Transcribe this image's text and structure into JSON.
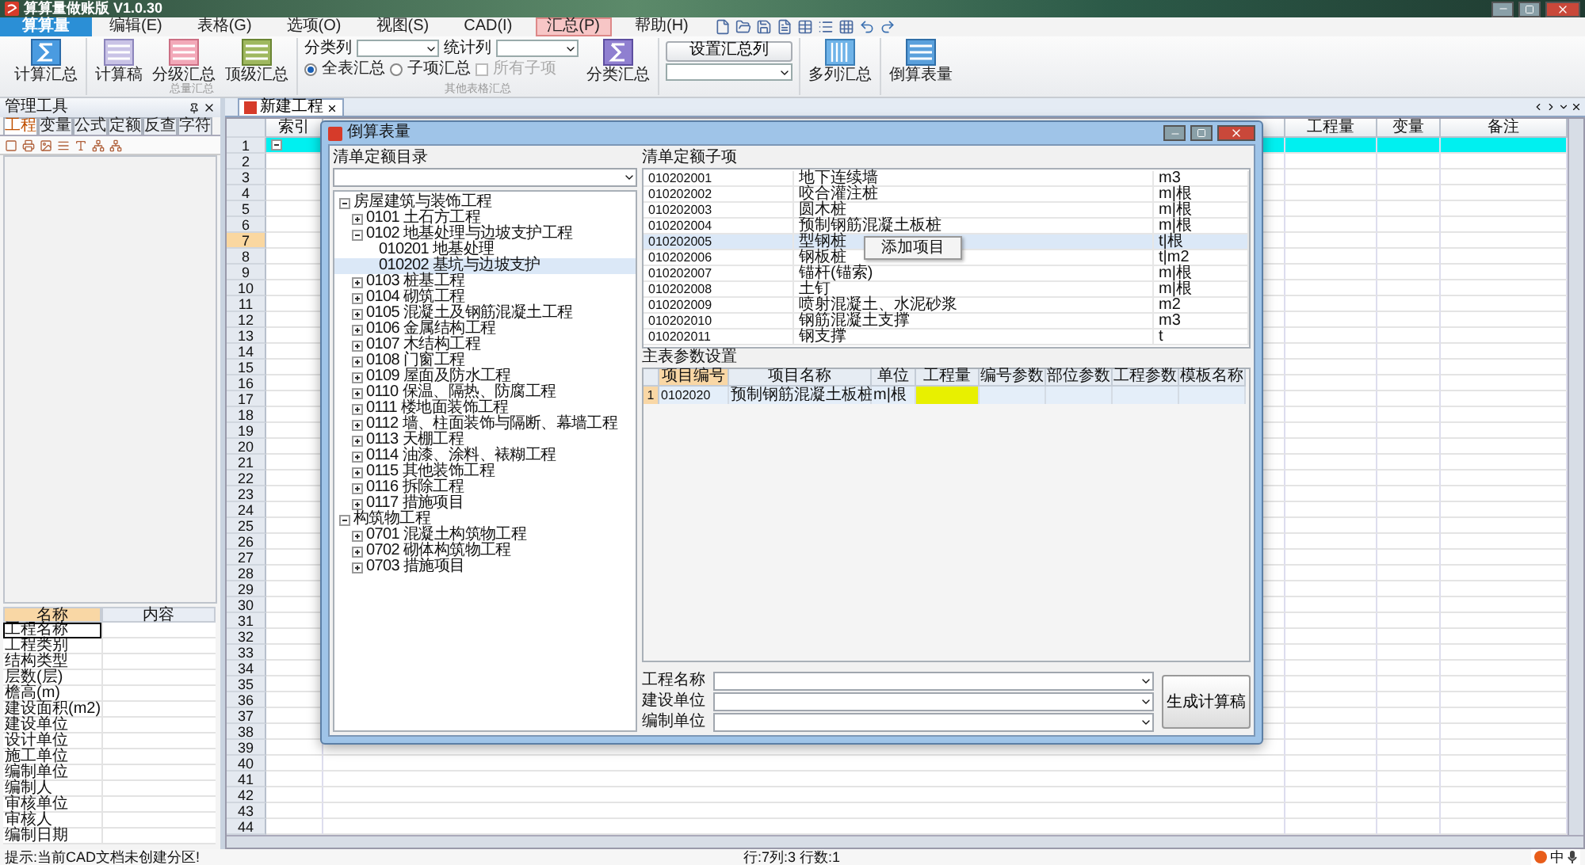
{
  "window": {
    "title": "算算量做账版 V1.0.30"
  },
  "app_button": {
    "label": "算算量"
  },
  "menu": [
    {
      "label": "编辑(E)",
      "selected": false
    },
    {
      "label": "表格(G)",
      "selected": false
    },
    {
      "label": "选项(O)",
      "selected": false
    },
    {
      "label": "视图(S)",
      "selected": false
    },
    {
      "label": "CAD(I)",
      "selected": false
    },
    {
      "label": "汇总(P)",
      "selected": true
    },
    {
      "label": "帮助(H)",
      "selected": false
    }
  ],
  "ribbon": {
    "sum_button": "计算汇总",
    "level_buttons": [
      "计算稿",
      "分级汇总",
      "顶级汇总"
    ],
    "level_group_label": "总量汇总",
    "category_label": "分类列",
    "stat_label": "统计列",
    "radios": [
      {
        "label": "全表汇总",
        "selected": true
      },
      {
        "label": "子项汇总",
        "selected": false
      }
    ],
    "all_children": {
      "label": "所有子项",
      "checked": false,
      "disabled": true
    },
    "category_button": "分类汇总",
    "other_group_label": "其他表格汇总",
    "set_columns_button": "设置汇总列",
    "multi_button": "多列汇总",
    "reverse_button": "倒算表量"
  },
  "left_panel": {
    "title": "管理工具",
    "tabs": [
      {
        "label": "工程",
        "selected": true
      },
      {
        "label": "变量",
        "selected": false
      },
      {
        "label": "公式",
        "selected": false
      },
      {
        "label": "定额",
        "selected": false
      },
      {
        "label": "反查",
        "selected": false
      },
      {
        "label": "字符",
        "selected": false
      }
    ],
    "properties": {
      "columns": [
        "名称",
        "内容"
      ],
      "rows": [
        {
          "name": "工程名称",
          "selected": true
        },
        {
          "name": "工程类别",
          "selected": false
        },
        {
          "name": "结构类型",
          "selected": false
        },
        {
          "name": "层数(层)",
          "selected": false
        },
        {
          "name": "檐高(m)",
          "selected": false
        },
        {
          "name": "建设面积(m2)",
          "selected": false
        },
        {
          "name": "建设单位",
          "selected": false
        },
        {
          "name": "设计单位",
          "selected": false
        },
        {
          "name": "施工单位",
          "selected": false
        },
        {
          "name": "编制单位",
          "selected": false
        },
        {
          "name": "编制人",
          "selected": false
        },
        {
          "name": "审核单位",
          "selected": false
        },
        {
          "name": "审核人",
          "selected": false
        },
        {
          "name": "编制日期",
          "selected": false
        }
      ]
    }
  },
  "document_tab": {
    "label": "新建工程"
  },
  "grid": {
    "columns": [
      "索引",
      "工程量",
      "变量",
      "备注"
    ],
    "rows": [
      {
        "number": "1",
        "selected": true,
        "current": false
      },
      {
        "number": "2",
        "selected": false,
        "current": false
      },
      {
        "number": "3",
        "selected": false,
        "current": false
      },
      {
        "number": "4",
        "selected": false,
        "current": false
      },
      {
        "number": "5",
        "selected": false,
        "current": false
      },
      {
        "number": "6",
        "selected": false,
        "current": false
      },
      {
        "number": "7",
        "selected": false,
        "current": true
      },
      {
        "number": "8",
        "selected": false,
        "current": false
      },
      {
        "number": "9",
        "selected": false,
        "current": false
      },
      {
        "number": "10",
        "selected": false,
        "current": false
      },
      {
        "number": "11",
        "selected": false,
        "current": false
      },
      {
        "number": "12",
        "selected": false,
        "current": false
      },
      {
        "number": "13",
        "selected": false,
        "current": false
      },
      {
        "number": "14",
        "selected": false,
        "current": false
      },
      {
        "number": "15",
        "selected": false,
        "current": false
      },
      {
        "number": "16",
        "selected": false,
        "current": false
      },
      {
        "number": "17",
        "selected": false,
        "current": false
      },
      {
        "number": "18",
        "selected": false,
        "current": false
      },
      {
        "number": "19",
        "selected": false,
        "current": false
      },
      {
        "number": "20",
        "selected": false,
        "current": false
      },
      {
        "number": "21",
        "selected": false,
        "current": false
      },
      {
        "number": "22",
        "selected": false,
        "current": false
      },
      {
        "number": "23",
        "selected": false,
        "current": false
      },
      {
        "number": "24",
        "selected": false,
        "current": false
      },
      {
        "number": "25",
        "selected": false,
        "current": false
      },
      {
        "number": "26",
        "selected": false,
        "current": false
      },
      {
        "number": "27",
        "selected": false,
        "current": false
      },
      {
        "number": "28",
        "selected": false,
        "current": false
      },
      {
        "number": "29",
        "selected": false,
        "current": false
      },
      {
        "number": "30",
        "selected": false,
        "current": false
      },
      {
        "number": "31",
        "selected": false,
        "current": false
      },
      {
        "number": "32",
        "selected": false,
        "current": false
      },
      {
        "number": "33",
        "selected": false,
        "current": false
      },
      {
        "number": "34",
        "selected": false,
        "current": false
      },
      {
        "number": "35",
        "selected": false,
        "current": false
      },
      {
        "number": "36",
        "selected": false,
        "current": false
      },
      {
        "number": "37",
        "selected": false,
        "current": false
      },
      {
        "number": "38",
        "selected": false,
        "current": false
      },
      {
        "number": "39",
        "selected": false,
        "current": false
      },
      {
        "number": "40",
        "selected": false,
        "current": false
      },
      {
        "number": "41",
        "selected": false,
        "current": false
      },
      {
        "number": "42",
        "selected": false,
        "current": false
      },
      {
        "number": "43",
        "selected": false,
        "current": false
      },
      {
        "number": "44",
        "selected": false,
        "current": false
      }
    ]
  },
  "dialog": {
    "title": "倒算表量",
    "catalog": {
      "label": "清单定额目录",
      "tree": [
        {
          "label": "房屋建筑与装饰工程",
          "expanded": true,
          "selected": false,
          "children": [
            {
              "label": "0101 土石方工程",
              "expanded": false,
              "selected": false
            },
            {
              "label": "0102 地基处理与边坡支护工程",
              "expanded": true,
              "selected": false,
              "children": [
                {
                  "label": "010201 地基处理",
                  "selected": false
                },
                {
                  "label": "010202 基坑与边坡支护",
                  "selected": true
                }
              ]
            },
            {
              "label": "0103 桩基工程",
              "expanded": false,
              "selected": false
            },
            {
              "label": "0104 砌筑工程",
              "expanded": false,
              "selected": false
            },
            {
              "label": "0105 混凝土及钢筋混凝土工程",
              "expanded": false,
              "selected": false
            },
            {
              "label": "0106 金属结构工程",
              "expanded": false,
              "selected": false
            },
            {
              "label": "0107 木结构工程",
              "expanded": false,
              "selected": false
            },
            {
              "label": "0108 门窗工程",
              "expanded": false,
              "selected": false
            },
            {
              "label": "0109 屋面及防水工程",
              "expanded": false,
              "selected": false
            },
            {
              "label": "0110 保温、隔热、防腐工程",
              "expanded": false,
              "selected": false
            },
            {
              "label": "0111 楼地面装饰工程",
              "expanded": false,
              "selected": false
            },
            {
              "label": "0112 墙、柱面装饰与隔断、幕墙工程",
              "expanded": false,
              "selected": false
            },
            {
              "label": "0113 天棚工程",
              "expanded": false,
              "selected": false
            },
            {
              "label": "0114 油漆、涂料、裱糊工程",
              "expanded": false,
              "selected": false
            },
            {
              "label": "0115 其他装饰工程",
              "expanded": false,
              "selected": false
            },
            {
              "label": "0116 拆除工程",
              "expanded": false,
              "selected": false
            },
            {
              "label": "0117 措施项目",
              "expanded": false,
              "selected": false
            }
          ]
        },
        {
          "label": "构筑物工程",
          "expanded": true,
          "selected": false,
          "children": [
            {
              "label": "0701 混凝土构筑物工程",
              "expanded": false,
              "selected": false
            },
            {
              "label": "0702 砌体构筑物工程",
              "expanded": false,
              "selected": false
            },
            {
              "label": "0703 措施项目",
              "expanded": false,
              "selected": false
            }
          ]
        }
      ]
    },
    "items": {
      "label": "清单定额子项",
      "rows": [
        {
          "code": "010202001",
          "name": "地下连续墙",
          "unit": "m3",
          "selected": false
        },
        {
          "code": "010202002",
          "name": "咬合灌注桩",
          "unit": "m|根",
          "selected": false
        },
        {
          "code": "010202003",
          "name": "圆木桩",
          "unit": "m|根",
          "selected": false
        },
        {
          "code": "010202004",
          "name": "预制钢筋混凝土板桩",
          "unit": "m|根",
          "selected": false
        },
        {
          "code": "010202005",
          "name": "型钢桩",
          "unit": "t|根",
          "selected": true
        },
        {
          "code": "010202006",
          "name": "钢板桩",
          "unit": "t|m2",
          "selected": false
        },
        {
          "code": "010202007",
          "name": "锚杆(锚索)",
          "unit": "m|根",
          "selected": false
        },
        {
          "code": "010202008",
          "name": "土钉",
          "unit": "m|根",
          "selected": false
        },
        {
          "code": "010202009",
          "name": "喷射混凝土、水泥砂浆",
          "unit": "m2",
          "selected": false
        },
        {
          "code": "010202010",
          "name": "钢筋混凝土支撑",
          "unit": "m3",
          "selected": false
        },
        {
          "code": "010202011",
          "name": "钢支撑",
          "unit": "t",
          "selected": false
        }
      ]
    },
    "context_menu": {
      "items": [
        "添加项目"
      ]
    },
    "params": {
      "label": "主表参数设置",
      "columns": [
        {
          "label": "项目编号",
          "kind": "key"
        },
        {
          "label": "项目名称",
          "kind": "text"
        },
        {
          "label": "单位",
          "kind": "text"
        },
        {
          "label": "工程量",
          "kind": "input"
        },
        {
          "label": "编号参数",
          "kind": "text"
        },
        {
          "label": "部位参数",
          "kind": "text"
        },
        {
          "label": "工程参数",
          "kind": "text"
        },
        {
          "label": "模板名称",
          "kind": "text"
        }
      ],
      "rows": [
        {
          "number": "1",
          "cells": [
            "0102020",
            "预制钢筋混凝土板桩",
            "m|根"
          ]
        }
      ]
    },
    "fields": [
      {
        "label": "工程名称"
      },
      {
        "label": "建设单位"
      },
      {
        "label": "编制单位"
      }
    ],
    "generate_button": "生成计算稿"
  },
  "status_bar": {
    "hint": "提示:当前CAD文档未创建分区!",
    "position": "行:7列:3 行数:1",
    "ime": "中"
  }
}
